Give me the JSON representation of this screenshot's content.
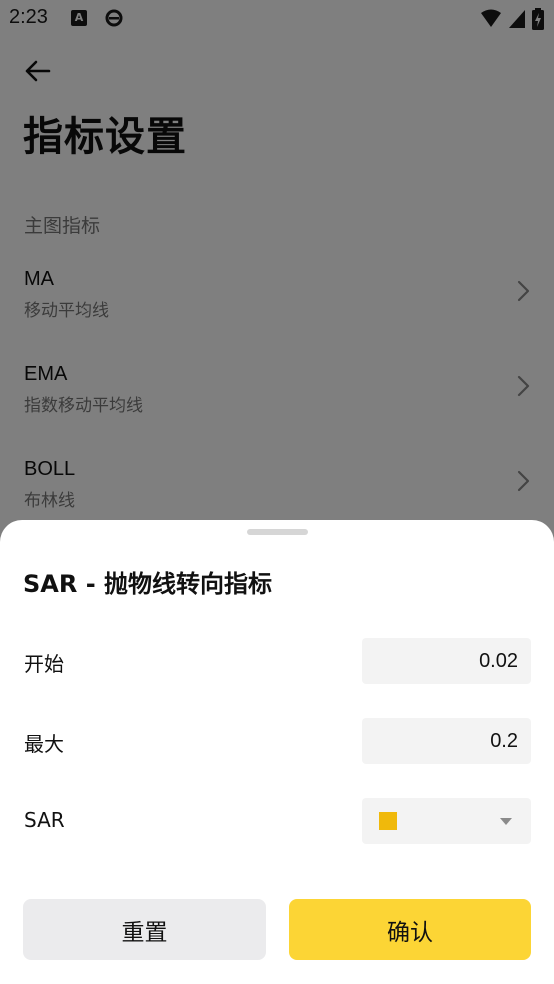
{
  "status_bar": {
    "time": "2:23",
    "icon_a_letter": "A"
  },
  "page": {
    "title": "指标设置",
    "section_label": "主图指标",
    "indicators": [
      {
        "name": "MA",
        "desc": "移动平均线"
      },
      {
        "name": "EMA",
        "desc": "指数移动平均线"
      },
      {
        "name": "BOLL",
        "desc": "布林线"
      }
    ]
  },
  "sheet": {
    "title": "SAR - 抛物线转向指标",
    "fields": [
      {
        "label": "开始",
        "value": "0.02"
      },
      {
        "label": "最大",
        "value": "0.2"
      }
    ],
    "color_field": {
      "label": "SAR",
      "color": "#F0B90B"
    },
    "reset_label": "重置",
    "confirm_label": "确认"
  },
  "colors": {
    "accent": "#FCD535",
    "overlay": "rgba(0,0,0,0.5)"
  },
  "icons": {
    "back": "arrow-left-icon",
    "chevron": "chevron-right-icon",
    "caret": "caret-down-icon"
  }
}
